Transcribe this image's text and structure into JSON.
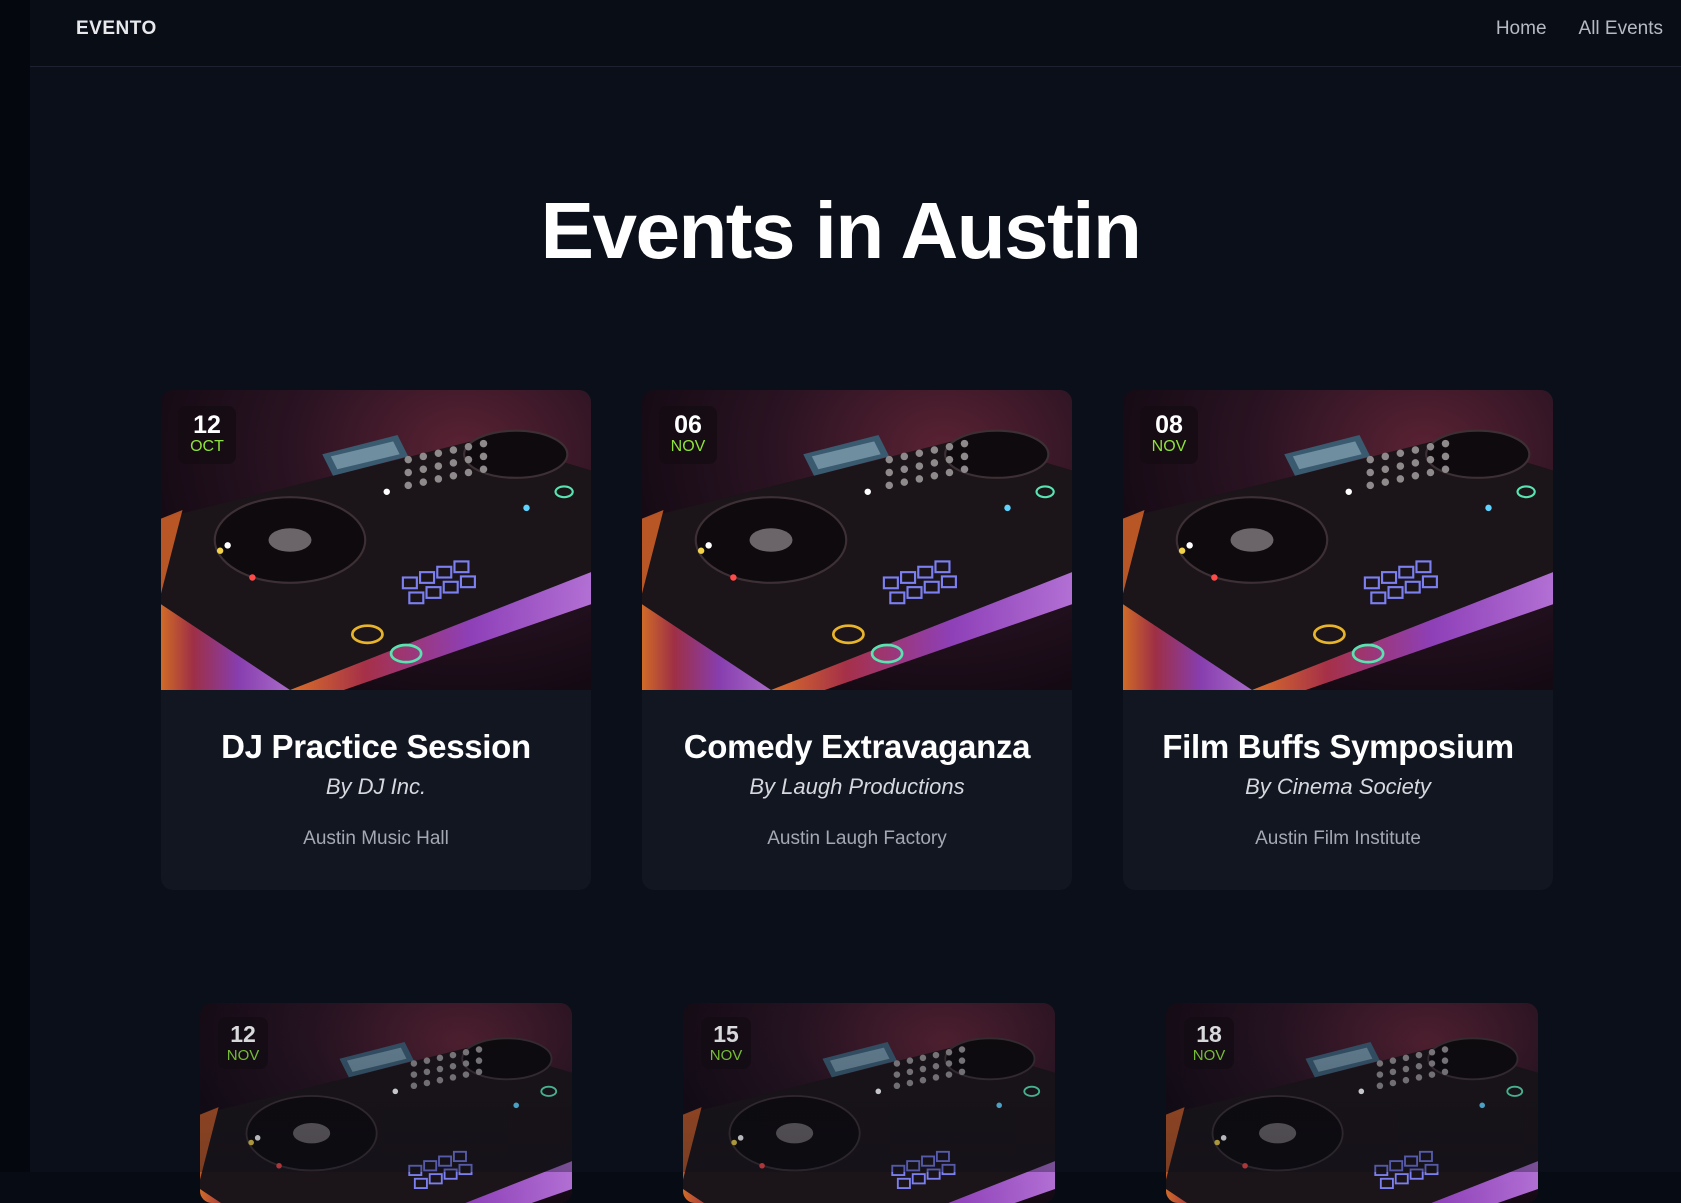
{
  "header": {
    "logo": "EVENTO",
    "nav": [
      {
        "label": "Home"
      },
      {
        "label": "All Events"
      }
    ]
  },
  "page": {
    "title": "Events in Austin"
  },
  "events": [
    {
      "day": "12",
      "month": "OCT",
      "title": "DJ Practice Session",
      "organizer": "By DJ Inc.",
      "venue": "Austin Music Hall"
    },
    {
      "day": "06",
      "month": "NOV",
      "title": "Comedy Extravaganza",
      "organizer": "By Laugh Productions",
      "venue": "Austin Laugh Factory"
    },
    {
      "day": "08",
      "month": "NOV",
      "title": "Film Buffs Symposium",
      "organizer": "By Cinema Society",
      "venue": "Austin Film Institute"
    },
    {
      "day": "12",
      "month": "NOV"
    },
    {
      "day": "15",
      "month": "NOV"
    },
    {
      "day": "18",
      "month": "NOV"
    }
  ],
  "colors": {
    "background": "#0a0f1a",
    "card": "#111621",
    "month_accent": "#8ee23c"
  }
}
